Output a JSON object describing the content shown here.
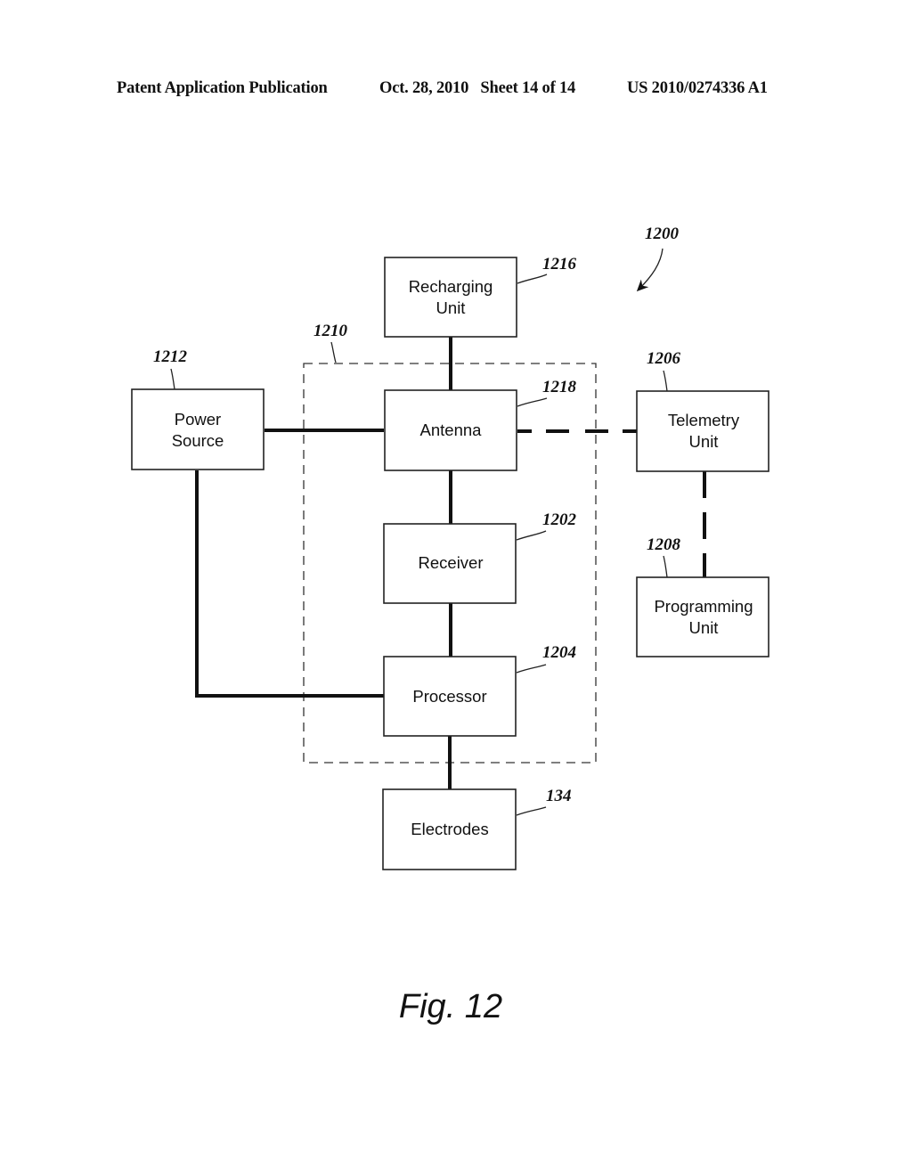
{
  "header": {
    "publication": "Patent Application Publication",
    "date_sheet": "Oct. 28, 2010   Sheet 14 of 14",
    "number": "US 2010/0274336 A1"
  },
  "diagram": {
    "system_ref": "1200",
    "group": {
      "ref": "1210",
      "style": "dashed-boundary"
    },
    "blocks": {
      "recharging_unit": {
        "lines": [
          "Recharging",
          "Unit"
        ],
        "ref": "1216"
      },
      "power_source": {
        "lines": [
          "Power",
          "Source"
        ],
        "ref": "1212"
      },
      "antenna": {
        "lines": [
          "Antenna"
        ],
        "ref": "1218"
      },
      "telemetry_unit": {
        "lines": [
          "Telemetry",
          "Unit"
        ],
        "ref": "1206"
      },
      "receiver": {
        "lines": [
          "Receiver"
        ],
        "ref": "1202"
      },
      "programming_unit": {
        "lines": [
          "Programming",
          "Unit"
        ],
        "ref": "1208"
      },
      "processor": {
        "lines": [
          "Processor"
        ],
        "ref": "1204"
      },
      "electrodes": {
        "lines": [
          "Electrodes"
        ],
        "ref": "134"
      }
    },
    "connections": [
      {
        "from": "recharging_unit",
        "to": "antenna",
        "style": "solid"
      },
      {
        "from": "power_source",
        "to": "antenna",
        "style": "solid"
      },
      {
        "from": "antenna",
        "to": "telemetry_unit",
        "style": "dashed"
      },
      {
        "from": "antenna",
        "to": "receiver",
        "style": "solid"
      },
      {
        "from": "receiver",
        "to": "processor",
        "style": "solid"
      },
      {
        "from": "power_source",
        "to": "processor",
        "style": "solid"
      },
      {
        "from": "processor",
        "to": "electrodes",
        "style": "solid"
      },
      {
        "from": "telemetry_unit",
        "to": "programming_unit",
        "style": "dashed"
      }
    ],
    "caption": "Fig. 12"
  }
}
